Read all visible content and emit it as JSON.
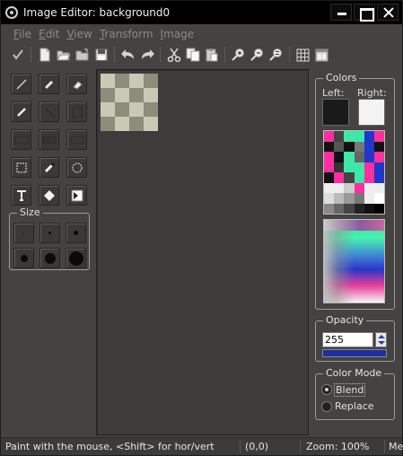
{
  "window": {
    "title": "Image Editor: background0"
  },
  "menu": [
    {
      "label": "File",
      "u": "F",
      "rest": "ile"
    },
    {
      "label": "Edit",
      "u": "E",
      "rest": "dit"
    },
    {
      "label": "View",
      "u": "V",
      "rest": "iew"
    },
    {
      "label": "Transform",
      "u": "T",
      "rest": "ransform"
    },
    {
      "label": "Image",
      "u": "I",
      "rest": "mage"
    }
  ],
  "toolbar_icons": [
    "apply-check-icon",
    "new-file-icon",
    "open-file-icon",
    "open-folder-icon",
    "save-icon",
    "undo-icon",
    "redo-icon",
    "cut-icon",
    "copy-icon",
    "paste-icon",
    "zoom-in-icon",
    "zoom-out-icon",
    "zoom-reset-icon",
    "grid-icon",
    "image-view-icon"
  ],
  "tools": [
    "line-icon",
    "pencil-icon",
    "eraser-icon",
    "brush-icon",
    "diagonal-line-icon",
    "fill-icon",
    "rectangle-icon",
    "filled-rectangle-icon",
    "rounded-rectangle-icon",
    "select-rect-icon",
    "color-picker-icon",
    "select-ellipse-icon",
    "text-icon",
    "fill-bucket-icon",
    "flood-icon"
  ],
  "size": {
    "label": "Size",
    "options": [
      "size-1-icon",
      "size-2-icon",
      "size-3-icon",
      "size-4-icon",
      "size-5-icon",
      "size-6-icon"
    ]
  },
  "colors": {
    "label": "Colors",
    "left_label": "Left:",
    "right_label": "Right:",
    "left_color": "#1a1a1a",
    "right_color": "#f4f4f4",
    "palette": [
      "#ff2fa0",
      "#444444",
      "#3fe8a8",
      "#3fe8a8",
      "#2236c8",
      "#ff2fa0",
      "#111111",
      "#555555",
      "#111111",
      "#777777",
      "#2236c8",
      "#111111",
      "#ff2fa0",
      "#111111",
      "#3fe8a8",
      "#666666",
      "#2236c8",
      "#ff2fa0",
      "#ff2fa0",
      "#333333",
      "#3fe8a8",
      "#3fe8a8",
      "#ff2fa0",
      "#2236c8",
      "#111111",
      "#ff2fa0",
      "#444444",
      "#3fe8a8",
      "#ff2fa0",
      "#2236c8",
      "#eeeeee",
      "#eeeeee",
      "#cccccc",
      "#ff2fa0",
      "#eeeeee",
      "#eeeeee",
      "#dddddd",
      "#bbbbbb",
      "#999999",
      "#777777",
      "#eeeeee",
      "#ffffff",
      "#888888",
      "#666666",
      "#444444",
      "#222222",
      "#111111",
      "#000000"
    ]
  },
  "opacity": {
    "label": "Opacity",
    "value": "255"
  },
  "color_mode": {
    "label": "Color Mode",
    "options": [
      "Blend",
      "Replace"
    ],
    "selected": "Blend"
  },
  "status": {
    "hint": "Paint with the mouse, <Shift> for hor/vert",
    "coords": "(0,0)",
    "zoom": "Zoom: 100%",
    "extra": "Me"
  }
}
